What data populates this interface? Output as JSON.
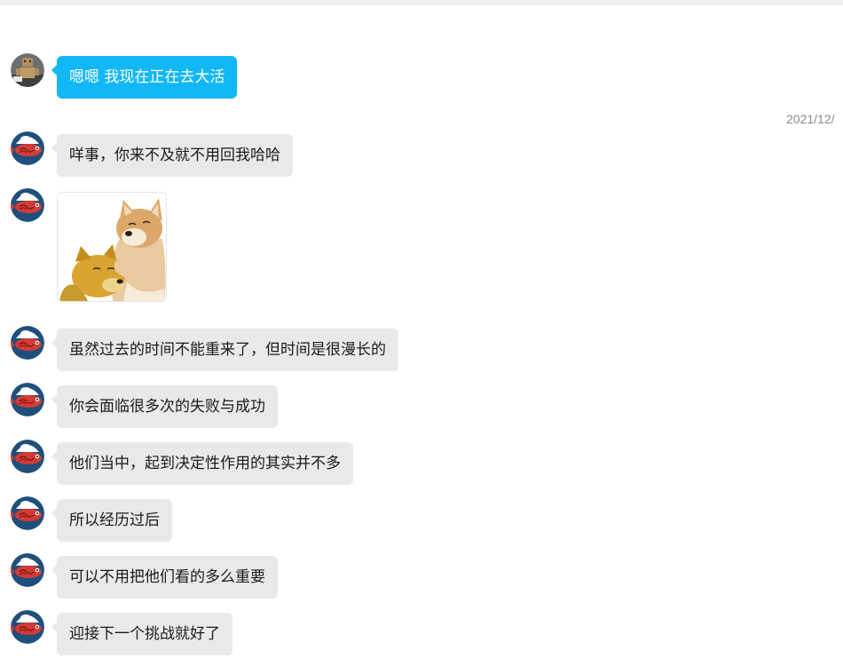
{
  "chat": {
    "timestamp": "2021/12/",
    "messages": [
      {
        "sender": "self",
        "text": "嗯嗯 我现在正在去大活",
        "type": "text"
      },
      {
        "sender": "friend",
        "text": "咩事，你来不及就不用回我哈哈",
        "type": "text"
      },
      {
        "sender": "friend",
        "type": "image",
        "image": "doge-hug-sticker"
      },
      {
        "sender": "friend",
        "text": "虽然过去的时间不能重来了，但时间是很漫长的",
        "type": "text"
      },
      {
        "sender": "friend",
        "text": "你会面临很多次的失败与成功",
        "type": "text"
      },
      {
        "sender": "friend",
        "text": "他们当中，起到决定性作用的其实并不多",
        "type": "text"
      },
      {
        "sender": "friend",
        "text": "所以经历过后",
        "type": "text"
      },
      {
        "sender": "friend",
        "text": "可以不用把他们看的多么重要",
        "type": "text"
      },
      {
        "sender": "friend",
        "text": "迎接下一个挑战就好了",
        "type": "text"
      }
    ]
  },
  "colors": {
    "self_bubble": "#12b7f5",
    "friend_bubble": "#e9e9e9",
    "timestamp": "#8a8a8a"
  },
  "icons": {
    "self_avatar": "cardboard-robot-avatar",
    "friend_avatar": "koinobori-fish-avatar"
  }
}
